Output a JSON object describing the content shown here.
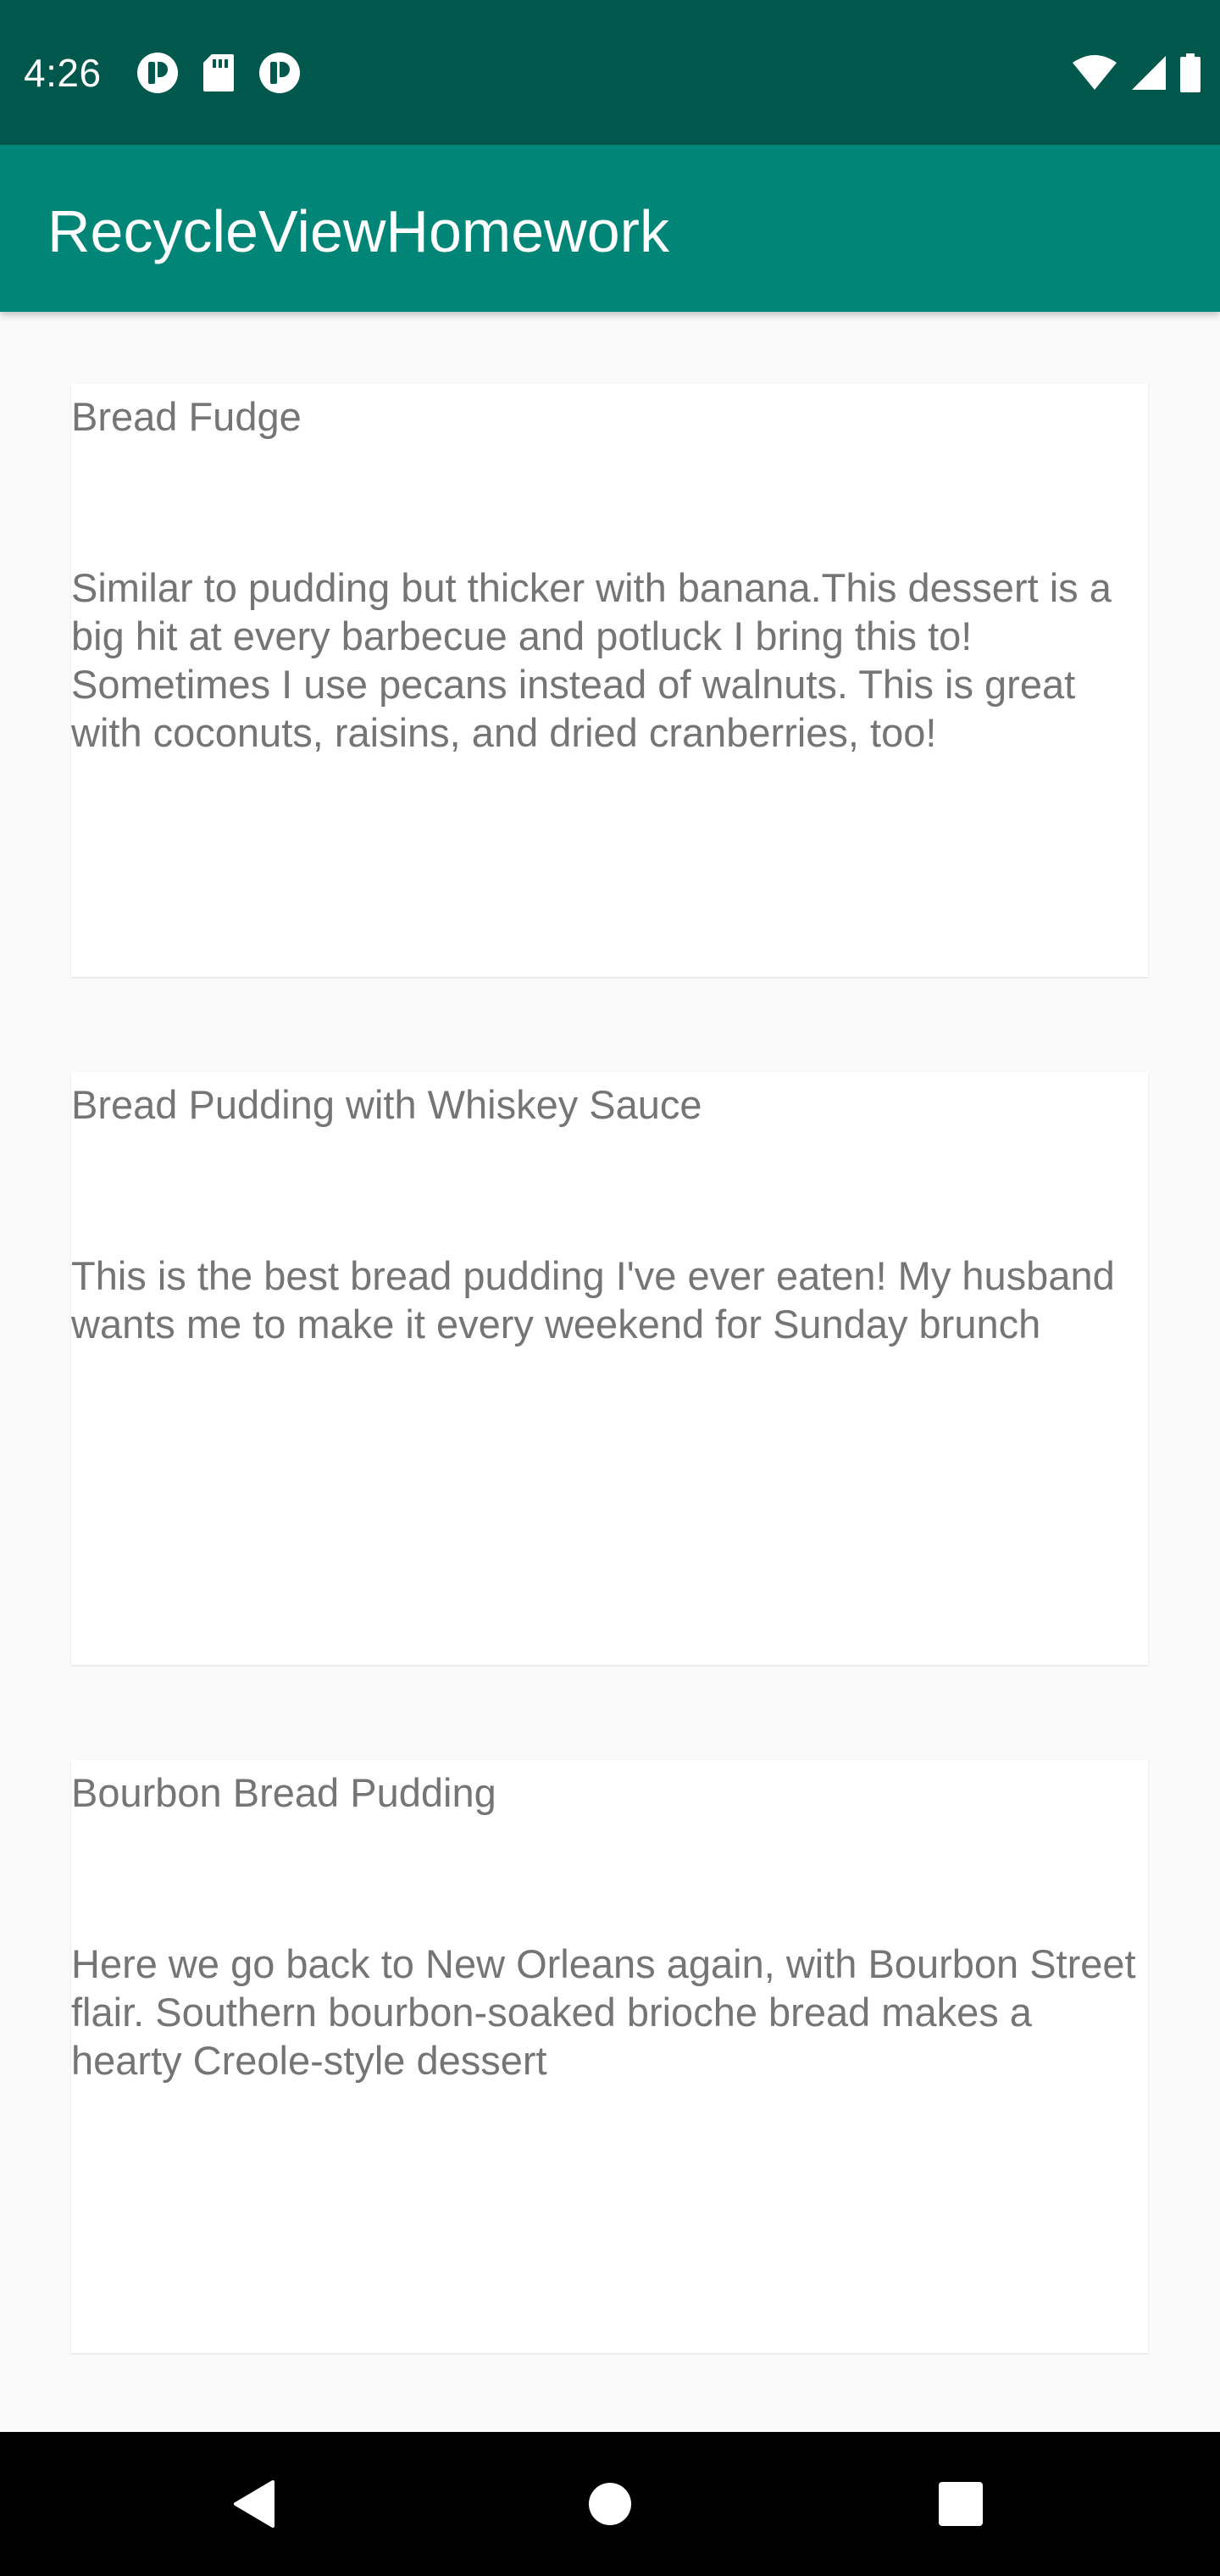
{
  "status_bar": {
    "time": "4:26",
    "left_icons": [
      "app-notification-icon",
      "sd-card-icon",
      "app-notification-icon"
    ],
    "right_icons": [
      "wifi-icon",
      "cell-signal-icon",
      "battery-icon"
    ],
    "background_color": "#00574b"
  },
  "app_bar": {
    "title": "RecycleViewHomework",
    "background_color": "#008577"
  },
  "recipes": [
    {
      "title": "Bread Fudge",
      "description": "Similar to pudding but thicker with banana.This dessert is a big hit at every barbecue and potluck I bring this to! Sometimes I use pecans instead of walnuts. This is great with coconuts, raisins, and dried cranberries, too!"
    },
    {
      "title": "Bread Pudding with Whiskey Sauce",
      "description": "This is the best bread pudding I've ever eaten! My husband wants me to make it every weekend for Sunday brunch"
    },
    {
      "title": "Bourbon Bread Pudding",
      "description": "Here we go back to New Orleans again, with Bourbon Street flair. Southern bourbon-soaked brioche bread makes a hearty Creole-style dessert"
    }
  ],
  "nav_bar": {
    "buttons": [
      "back-icon",
      "home-icon",
      "recents-icon"
    ]
  }
}
